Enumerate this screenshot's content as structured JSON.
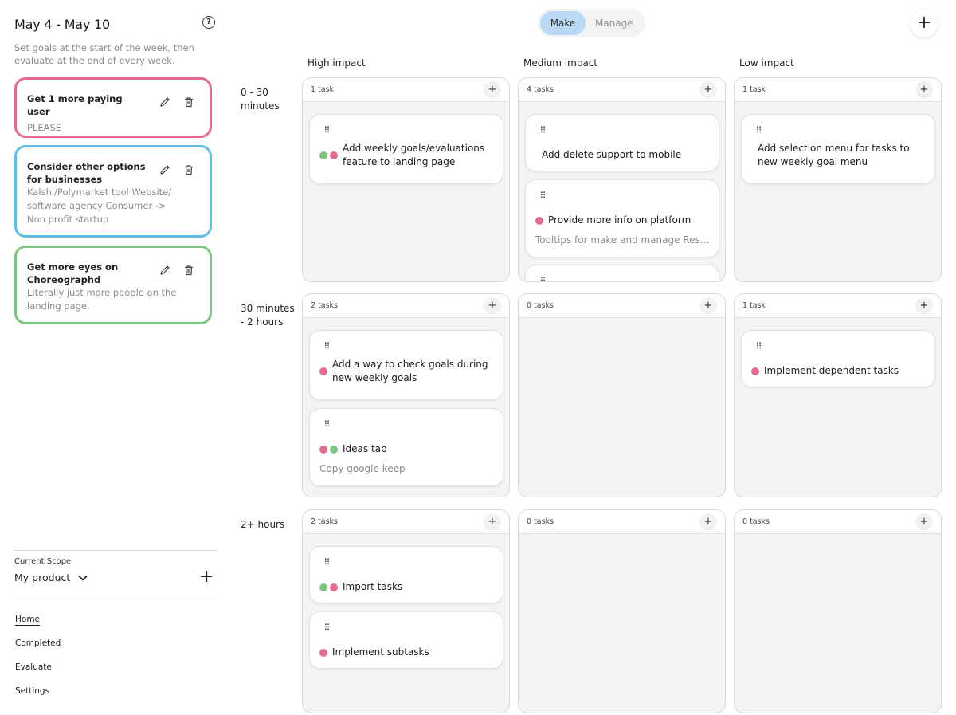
{
  "sidebar": {
    "week_title": "May 4 - May 10",
    "help_icon": "?",
    "subtitle": "Set goals at the start of the week, then evaluate at the end of every week.",
    "goals": [
      {
        "title": "Get 1 more paying user",
        "description": "PLEASE",
        "color": "#e56b92"
      },
      {
        "title": "Consider other options for businesses",
        "description": "Kalshi/Polymarket tool Website/ software agency Consumer -> Non profit startup",
        "color": "#5ebde6"
      },
      {
        "title": "Get more eyes on Choreographd",
        "description": "Literally just more people on the landing page.",
        "color": "#7cc77d"
      }
    ],
    "scope_label": "Current Scope",
    "scope_value": "My product",
    "scope_add": "+",
    "nav": [
      "Home",
      "Completed",
      "Evaluate",
      "Settings"
    ]
  },
  "toolbar": {
    "make_label": "Make",
    "manage_label": "Manage",
    "add_label": "+"
  },
  "board": {
    "columns": [
      "High impact",
      "Medium impact",
      "Low impact"
    ],
    "rows": [
      "0 - 30 minutes",
      "30 minutes - 2 hours",
      "2+ hours"
    ],
    "add_label": "+",
    "grip_icon": "⠿",
    "cells": {
      "r0c0": {
        "count": "1 task",
        "tasks": [
          {
            "title": "Add weekly goals/evaluations feature to landing page",
            "dots": [
              "#7cc77d",
              "#e56b92"
            ]
          }
        ]
      },
      "r0c1": {
        "count": "4 tasks",
        "tasks": [
          {
            "title": "Add delete support to mobile",
            "dots": []
          },
          {
            "title": "Provide more info on platform",
            "desc": "Tooltips for make and manage Resear…",
            "dots": [
              "#e56b92"
            ]
          }
        ]
      },
      "r0c2": {
        "count": "1 task",
        "tasks": [
          {
            "title": "Add selection menu for tasks to new weekly goal menu",
            "dots": []
          }
        ]
      },
      "r1c0": {
        "count": "2 tasks",
        "tasks": [
          {
            "title": "Add a way to check goals during new weekly goals",
            "dots": [
              "#e56b92"
            ]
          },
          {
            "title": "Ideas tab",
            "desc": "Copy google keep",
            "dots": [
              "#e56b92",
              "#7cc77d"
            ]
          }
        ]
      },
      "r1c1": {
        "count": "0 tasks",
        "tasks": []
      },
      "r1c2": {
        "count": "1 task",
        "tasks": [
          {
            "title": "Implement dependent tasks",
            "dots": [
              "#e56b92"
            ]
          }
        ]
      },
      "r2c0": {
        "count": "2 tasks",
        "tasks": [
          {
            "title": "Import tasks",
            "dots": [
              "#7cc77d",
              "#e56b92"
            ]
          },
          {
            "title": "Implement subtasks",
            "dots": [
              "#e56b92"
            ]
          }
        ]
      },
      "r2c1": {
        "count": "0 tasks",
        "tasks": []
      },
      "r2c2": {
        "count": "0 tasks",
        "tasks": []
      }
    }
  }
}
